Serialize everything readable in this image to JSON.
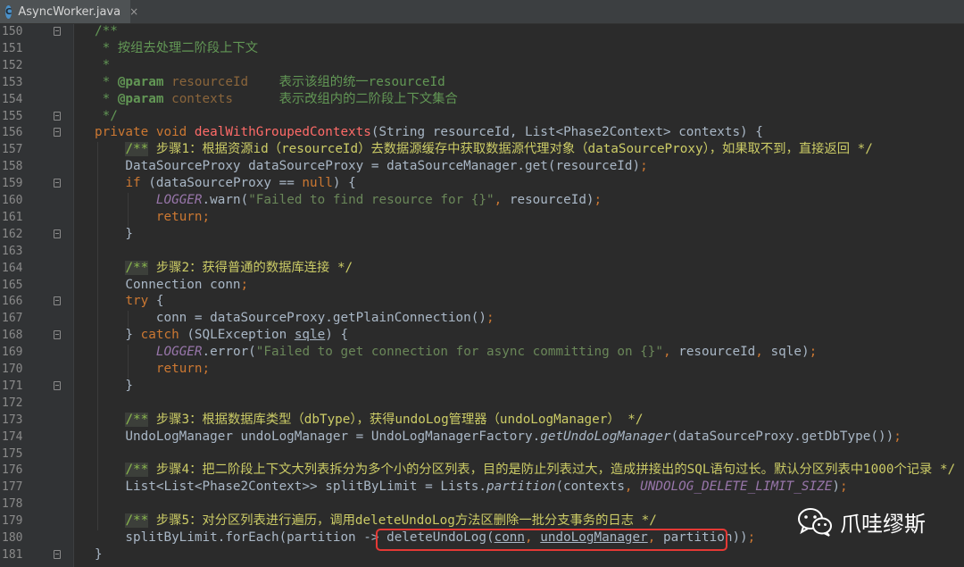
{
  "tab": {
    "filename": "AsyncWorker.java",
    "icon": "C",
    "close": "×"
  },
  "colors": {
    "background": "#2b2b2b",
    "keyword": "#cc7832",
    "doc": "#629755",
    "highlight_box": "#e53935"
  },
  "lines": [
    {
      "n": "150",
      "fold": true,
      "html": "<span class='c-doc'>/**</span>"
    },
    {
      "n": "151",
      "html": "<span class='c-doc'> * 按组去处理二阶段上下文</span>"
    },
    {
      "n": "152",
      "html": "<span class='c-doc'> *</span>"
    },
    {
      "n": "153",
      "html": "<span class='c-doc'> * </span><span class='c-tag'>@param</span><span class='c-tagname'> resourceId</span><span class='c-doc'>    表示该组的统一resourceId</span>"
    },
    {
      "n": "154",
      "html": "<span class='c-doc'> * </span><span class='c-tag'>@param</span><span class='c-tagname'> contexts</span><span class='c-doc'>      表示改组内的二阶段上下文集合</span>"
    },
    {
      "n": "155",
      "fold": true,
      "html": "<span class='c-doc'> */</span>"
    },
    {
      "n": "156",
      "fold": true,
      "html": "<span class='c-kw'>private void </span><span class='c-fn'>dealWithGroupedContexts</span>(String resourceId, List&lt;Phase2Context&gt; contexts) {"
    },
    {
      "n": "157",
      "html": "    <span class='c-blktag hl'>/**</span><span class='c-blk'> 步骤1：根据资源id（resourceId）去数据源缓存中获取数据源代理对象（dataSourceProxy），如果取不到，直接返回 */</span>"
    },
    {
      "n": "158",
      "html": "    DataSourceProxy dataSourceProxy = dataSourceManager.get(resourceId)<span class='c-kw'>;</span>"
    },
    {
      "n": "159",
      "fold": true,
      "html": "    <span class='c-kw'>if </span>(dataSourceProxy == <span class='c-kw'>null</span>) {"
    },
    {
      "n": "160",
      "html": "        <span class='c-log'>LOGGER</span>.warn(<span class='c-str'>\"Failed to find resource for {}\"</span><span class='c-kw'>, </span>resourceId)<span class='c-kw'>;</span>"
    },
    {
      "n": "161",
      "html": "        <span class='c-kw'>return;</span>"
    },
    {
      "n": "162",
      "fold": true,
      "html": "    }"
    },
    {
      "n": "163",
      "html": ""
    },
    {
      "n": "164",
      "html": "    <span class='c-blktag hl'>/**</span><span class='c-blk'> 步骤2：获得普通的数据库连接 */</span>"
    },
    {
      "n": "165",
      "html": "    Connection conn<span class='c-kw'>;</span>"
    },
    {
      "n": "166",
      "fold": true,
      "html": "    <span class='c-kw'>try </span>{"
    },
    {
      "n": "167",
      "html": "        conn = dataSourceProxy.getPlainConnection()<span class='c-kw'>;</span>"
    },
    {
      "n": "168",
      "fold": true,
      "html": "    } <span class='c-kw'>catch </span>(SQLException <span class='c-sqle'>sqle</span>) {"
    },
    {
      "n": "169",
      "html": "        <span class='c-log'>LOGGER</span>.error(<span class='c-str'>\"Failed to get connection for async committing on {}\"</span><span class='c-kw'>, </span>resourceId<span class='c-kw'>, </span>sqle)<span class='c-kw'>;</span>"
    },
    {
      "n": "170",
      "html": "        <span class='c-kw'>return;</span>"
    },
    {
      "n": "171",
      "fold": true,
      "html": "    }"
    },
    {
      "n": "172",
      "html": ""
    },
    {
      "n": "173",
      "html": "    <span class='c-blktag hl'>/**</span><span class='c-blk'> 步骤3：根据数据库类型（dbType），获得undoLog管理器（undoLogManager） */</span>"
    },
    {
      "n": "174",
      "html": "    UndoLogManager undoLogManager = UndoLogManagerFactory.<span class='c-static'>getUndoLogManager</span>(dataSourceProxy.getDbType())<span class='c-kw'>;</span>"
    },
    {
      "n": "175",
      "html": ""
    },
    {
      "n": "176",
      "html": "    <span class='c-blktag hl'>/**</span><span class='c-blk'> 步骤4：把二阶段上下文大列表拆分为多个小的分区列表，目的是防止列表过大，造成拼接出的SQL语句过长。默认分区列表中1000个记录 */</span>"
    },
    {
      "n": "177",
      "html": "    List&lt;List&lt;Phase2Context&gt;&gt; splitByLimit = Lists.<span class='c-static'>partition</span>(contexts<span class='c-kw'>, </span><span class='c-const'>UNDOLOG_DELETE_LIMIT_SIZE</span>)<span class='c-kw'>;</span>"
    },
    {
      "n": "178",
      "html": ""
    },
    {
      "n": "179",
      "html": "    <span class='c-blktag hl'>/**</span><span class='c-blk'> 步骤5：对分区列表进行遍历，调用deleteUndoLog方法区删除一批分支事务的日志 */</span>"
    },
    {
      "n": "180",
      "html": "    splitByLimit.forEach(partition -&gt; deleteUndoLog(<span class='c-param'>conn</span><span class='c-kw'>, </span><span class='c-param'>undoLogManager</span><span class='c-kw'>, </span>partition))<span class='c-kw'>;</span>"
    },
    {
      "n": "181",
      "fold": true,
      "html": "}"
    }
  ],
  "watermark": {
    "text": "爪哇缪斯",
    "icon": "wechat-icon"
  }
}
